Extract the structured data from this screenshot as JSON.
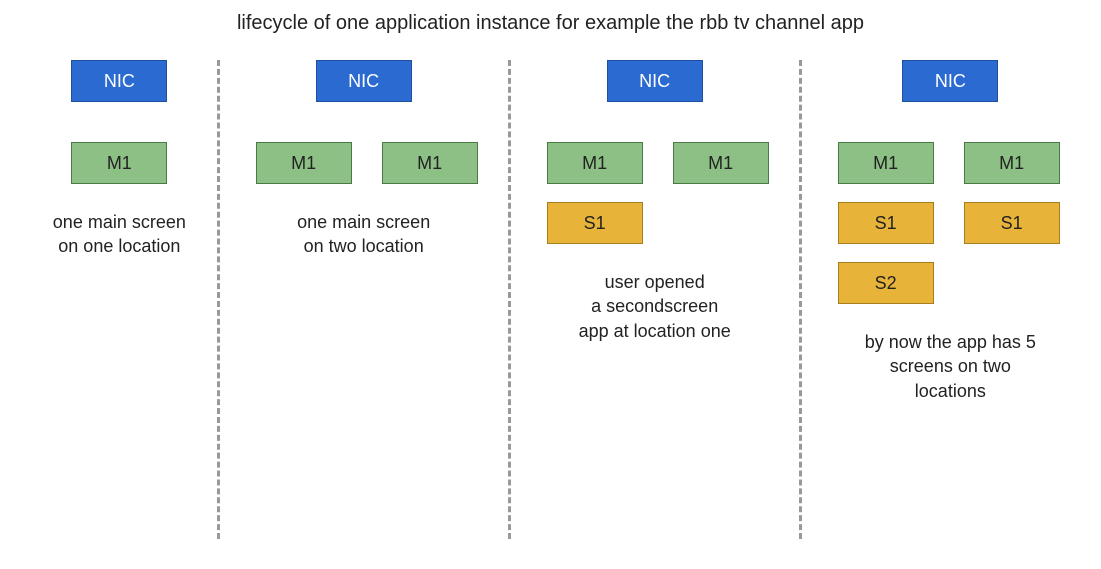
{
  "title": "lifecycle of one application instance for example the rbb  tv channel app",
  "labels": {
    "nic": "NIC",
    "m1": "M1",
    "s1": "S1",
    "s2": "S2"
  },
  "captions": {
    "p1": "one main screen\non one location",
    "p2": "one main screen\non two location",
    "p3": "user opened\na secondscreen\napp at location one",
    "p4": "by now the app has 5\nscreens on two\nlocations"
  },
  "colors": {
    "nic_bg": "#2b6bd1",
    "m1_bg": "#8cc084",
    "s_bg": "#e8b339"
  }
}
